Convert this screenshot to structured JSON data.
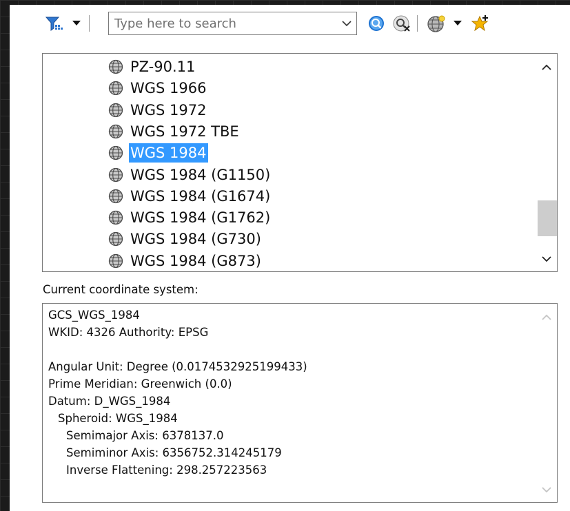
{
  "toolbar": {
    "filter_icon": "filter-icon",
    "search": {
      "placeholder": "Type here to search",
      "value": ""
    },
    "search_icon": "search-icon",
    "clear_search_icon": "clear-search-icon",
    "globe_menu_icon": "globe-icon",
    "favorite_icon": "add-favorite-star-icon"
  },
  "coordinate_list": {
    "items": [
      {
        "label": "PZ-90.11",
        "selected": false
      },
      {
        "label": "WGS 1966",
        "selected": false
      },
      {
        "label": "WGS 1972",
        "selected": false
      },
      {
        "label": "WGS 1972 TBE",
        "selected": false
      },
      {
        "label": "WGS 1984",
        "selected": true
      },
      {
        "label": "WGS 1984 (G1150)",
        "selected": false
      },
      {
        "label": "WGS 1984 (G1674)",
        "selected": false
      },
      {
        "label": "WGS 1984 (G1762)",
        "selected": false
      },
      {
        "label": "WGS 1984 (G730)",
        "selected": false
      },
      {
        "label": "WGS 1984 (G873)",
        "selected": false
      }
    ],
    "scroll_position": 0.75
  },
  "current": {
    "caption": "Current coordinate system:",
    "lines": [
      "GCS_WGS_1984",
      "WKID: 4326 Authority: EPSG",
      "",
      "Angular Unit: Degree (0.0174532925199433)",
      "Prime Meridian: Greenwich (0.0)",
      "Datum: D_WGS_1984",
      "Spheroid: WGS_1984",
      "Semimajor Axis: 6378137.0",
      "Semiminor Axis: 6356752.314245179",
      "Inverse Flattening: 298.257223563"
    ]
  },
  "colors": {
    "selection": "#3399ff",
    "accent_blue": "#1e73d2",
    "star": "#f5b400"
  }
}
